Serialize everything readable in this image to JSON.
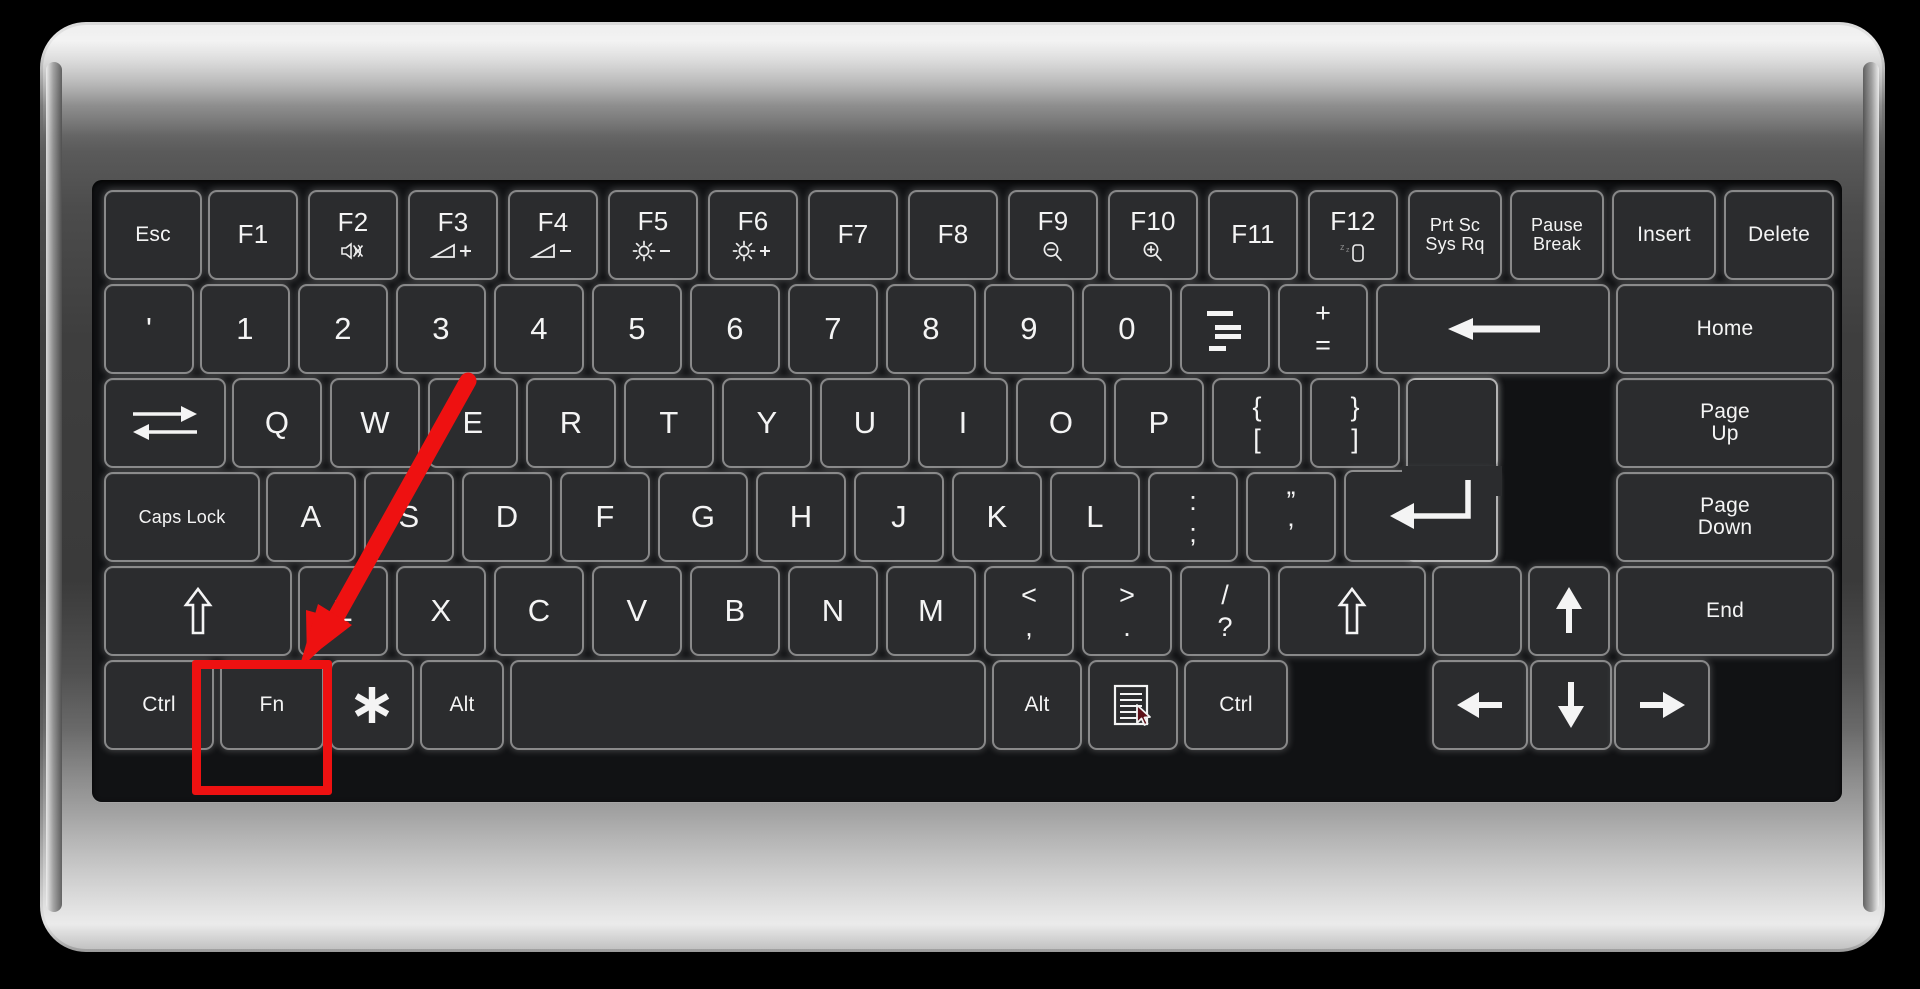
{
  "device": {
    "name": "laptop-keyboard",
    "body_color": "#3c3c3c",
    "key_color": "#2b2c2e",
    "key_text_color": "#f4f4f4",
    "annotation_color": "#ee1111"
  },
  "annotations": {
    "highlight": {
      "target_key": "Fn",
      "shape": "rectangle",
      "color": "#ee1111"
    },
    "arrow": {
      "points_to": "Fn",
      "color": "#ee1111",
      "direction": "down-left"
    }
  },
  "rows": [
    {
      "name": "function-row",
      "keys": [
        {
          "label": "Esc",
          "sub": "",
          "size": "small"
        },
        {
          "label": "F1",
          "sub": ""
        },
        {
          "label": "F2",
          "sub": "",
          "icon": "speaker-mute-icon"
        },
        {
          "label": "F3",
          "sub": "",
          "icon": "volume-up-icon"
        },
        {
          "label": "F4",
          "sub": "",
          "icon": "volume-down-icon"
        },
        {
          "label": "F5",
          "sub": "",
          "icon": "brightness-down-icon"
        },
        {
          "label": "F6",
          "sub": "",
          "icon": "brightness-up-icon"
        },
        {
          "label": "F7",
          "sub": ""
        },
        {
          "label": "F8",
          "sub": ""
        },
        {
          "label": "F9",
          "sub": "",
          "icon": "zoom-out-icon"
        },
        {
          "label": "F10",
          "sub": "",
          "icon": "zoom-in-icon"
        },
        {
          "label": "F11",
          "sub": ""
        },
        {
          "label": "F12",
          "sub": "",
          "icon": "sleep-icon"
        },
        {
          "label": "Prt Sc\nSys Rq",
          "size": "xsmall"
        },
        {
          "label": "Pause\nBreak",
          "size": "xsmall"
        },
        {
          "label": "Insert",
          "size": "small"
        },
        {
          "label": "Delete",
          "size": "small"
        }
      ]
    },
    {
      "name": "number-row",
      "keys": [
        {
          "label": "'"
        },
        {
          "label": "1"
        },
        {
          "label": "2"
        },
        {
          "label": "3"
        },
        {
          "label": "4"
        },
        {
          "label": "5"
        },
        {
          "label": "6"
        },
        {
          "label": "7"
        },
        {
          "label": "8"
        },
        {
          "label": "9"
        },
        {
          "label": "0"
        },
        {
          "label": "_ -",
          "icon": "underscore-minus-icon"
        },
        {
          "label": "+ =",
          "top": "+",
          "bot": "="
        },
        {
          "label": "Backspace",
          "icon": "backspace-arrow-icon"
        },
        {
          "label": "Home",
          "size": "small"
        }
      ]
    },
    {
      "name": "top-letter-row",
      "keys": [
        {
          "label": "Tab",
          "icon": "tab-arrows-icon"
        },
        {
          "label": "Q"
        },
        {
          "label": "W"
        },
        {
          "label": "E"
        },
        {
          "label": "R"
        },
        {
          "label": "T"
        },
        {
          "label": "Y"
        },
        {
          "label": "U"
        },
        {
          "label": "I"
        },
        {
          "label": "O"
        },
        {
          "label": "P"
        },
        {
          "label": "{ [",
          "top": "{",
          "bot": "["
        },
        {
          "label": "} ]",
          "top": "}",
          "bot": "]"
        },
        {
          "label": "\\ |",
          "top": "\\",
          "bot": "|"
        },
        {
          "label": "Page\nUp",
          "size": "small"
        }
      ]
    },
    {
      "name": "home-row",
      "keys": [
        {
          "label": "Caps Lock",
          "size": "xsmall"
        },
        {
          "label": "A"
        },
        {
          "label": "S"
        },
        {
          "label": "D"
        },
        {
          "label": "F"
        },
        {
          "label": "G"
        },
        {
          "label": "H"
        },
        {
          "label": "J"
        },
        {
          "label": "K"
        },
        {
          "label": "L"
        },
        {
          "label": ": ;",
          "top": ":",
          "bot": ";"
        },
        {
          "label": "\" '",
          "top": "”",
          "bot": "’"
        },
        {
          "label": "Enter",
          "icon": "enter-arrow-icon"
        },
        {
          "label": "Page\nDown",
          "size": "small"
        }
      ]
    },
    {
      "name": "bottom-letter-row",
      "keys": [
        {
          "label": "Shift",
          "icon": "shift-arrow-icon"
        },
        {
          "label": "Z"
        },
        {
          "label": "X"
        },
        {
          "label": "C"
        },
        {
          "label": "V"
        },
        {
          "label": "B"
        },
        {
          "label": "N"
        },
        {
          "label": "M"
        },
        {
          "label": "< ,",
          "top": "<",
          "bot": ","
        },
        {
          "label": "> .",
          "top": ">",
          "bot": "."
        },
        {
          "label": "/ ?",
          "top": "/",
          "bot": "?"
        },
        {
          "label": "Shift",
          "icon": "shift-arrow-icon"
        },
        {
          "label": "",
          "name": "blank-key"
        },
        {
          "label": "Up",
          "icon": "arrow-up-icon"
        },
        {
          "label": "End",
          "size": "small"
        }
      ]
    },
    {
      "name": "modifier-row",
      "keys": [
        {
          "label": "Ctrl",
          "size": "small"
        },
        {
          "label": "Fn",
          "size": "small",
          "highlighted": true
        },
        {
          "label": "*",
          "icon": "asterisk-icon"
        },
        {
          "label": "Alt",
          "size": "small"
        },
        {
          "label": "",
          "name": "spacebar"
        },
        {
          "label": "Alt",
          "size": "small"
        },
        {
          "label": "Menu",
          "icon": "context-menu-icon"
        },
        {
          "label": "Ctrl",
          "size": "small"
        },
        {
          "label": "Left",
          "icon": "arrow-left-icon"
        },
        {
          "label": "Down",
          "icon": "arrow-down-icon"
        },
        {
          "label": "Right",
          "icon": "arrow-right-icon"
        }
      ]
    }
  ]
}
